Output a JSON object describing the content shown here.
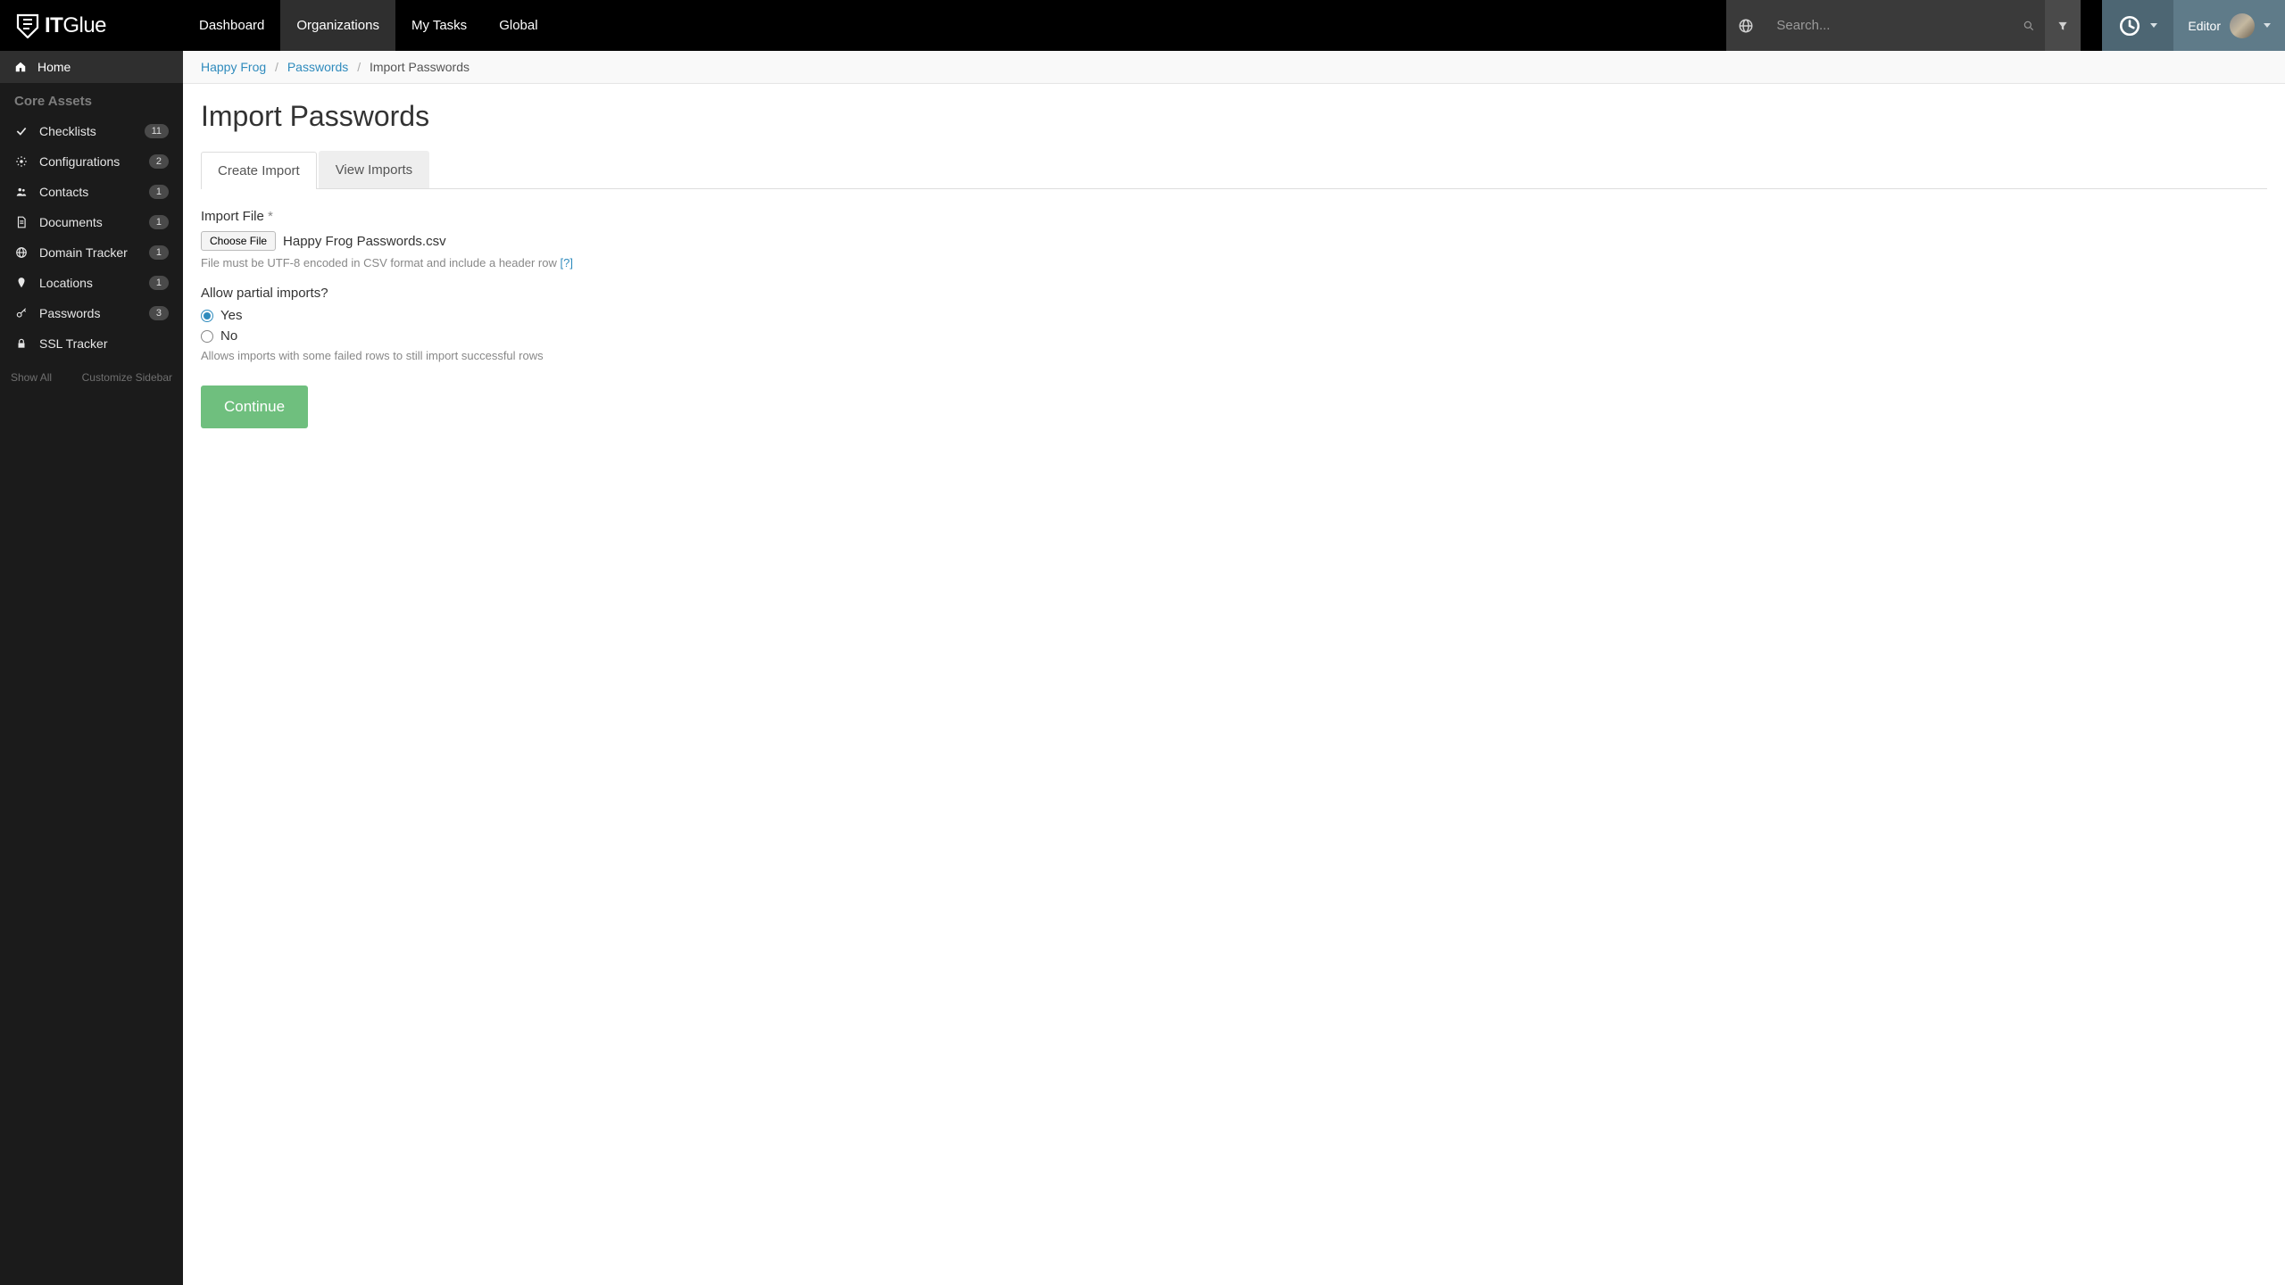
{
  "brand": {
    "name_bold": "IT",
    "name_light": "Glue"
  },
  "nav": {
    "items": [
      {
        "label": "Dashboard"
      },
      {
        "label": "Organizations"
      },
      {
        "label": "My Tasks"
      },
      {
        "label": "Global"
      }
    ],
    "search_placeholder": "Search...",
    "user_role": "Editor"
  },
  "sidebar": {
    "home": "Home",
    "section_title": "Core Assets",
    "items": [
      {
        "label": "Checklists",
        "count": "11"
      },
      {
        "label": "Configurations",
        "count": "2"
      },
      {
        "label": "Contacts",
        "count": "1"
      },
      {
        "label": "Documents",
        "count": "1"
      },
      {
        "label": "Domain Tracker",
        "count": "1"
      },
      {
        "label": "Locations",
        "count": "1"
      },
      {
        "label": "Passwords",
        "count": "3"
      },
      {
        "label": "SSL Tracker",
        "count": ""
      }
    ],
    "footer": {
      "show_all": "Show All",
      "customize": "Customize Sidebar"
    }
  },
  "breadcrumbs": {
    "org": "Happy Frog",
    "section": "Passwords",
    "current": "Import Passwords"
  },
  "page": {
    "title": "Import Passwords",
    "tabs": [
      {
        "label": "Create Import"
      },
      {
        "label": "View Imports"
      }
    ],
    "import_file": {
      "label": "Import File",
      "required_mark": "*",
      "choose_button": "Choose File",
      "file_name": "Happy Frog Passwords.csv",
      "help_prefix": "File must be UTF-8 encoded in CSV format and include a header row ",
      "help_link": "[?]"
    },
    "partial": {
      "label": "Allow partial imports?",
      "yes": "Yes",
      "no": "No",
      "help": "Allows imports with some failed rows to still import successful rows"
    },
    "continue": "Continue"
  }
}
